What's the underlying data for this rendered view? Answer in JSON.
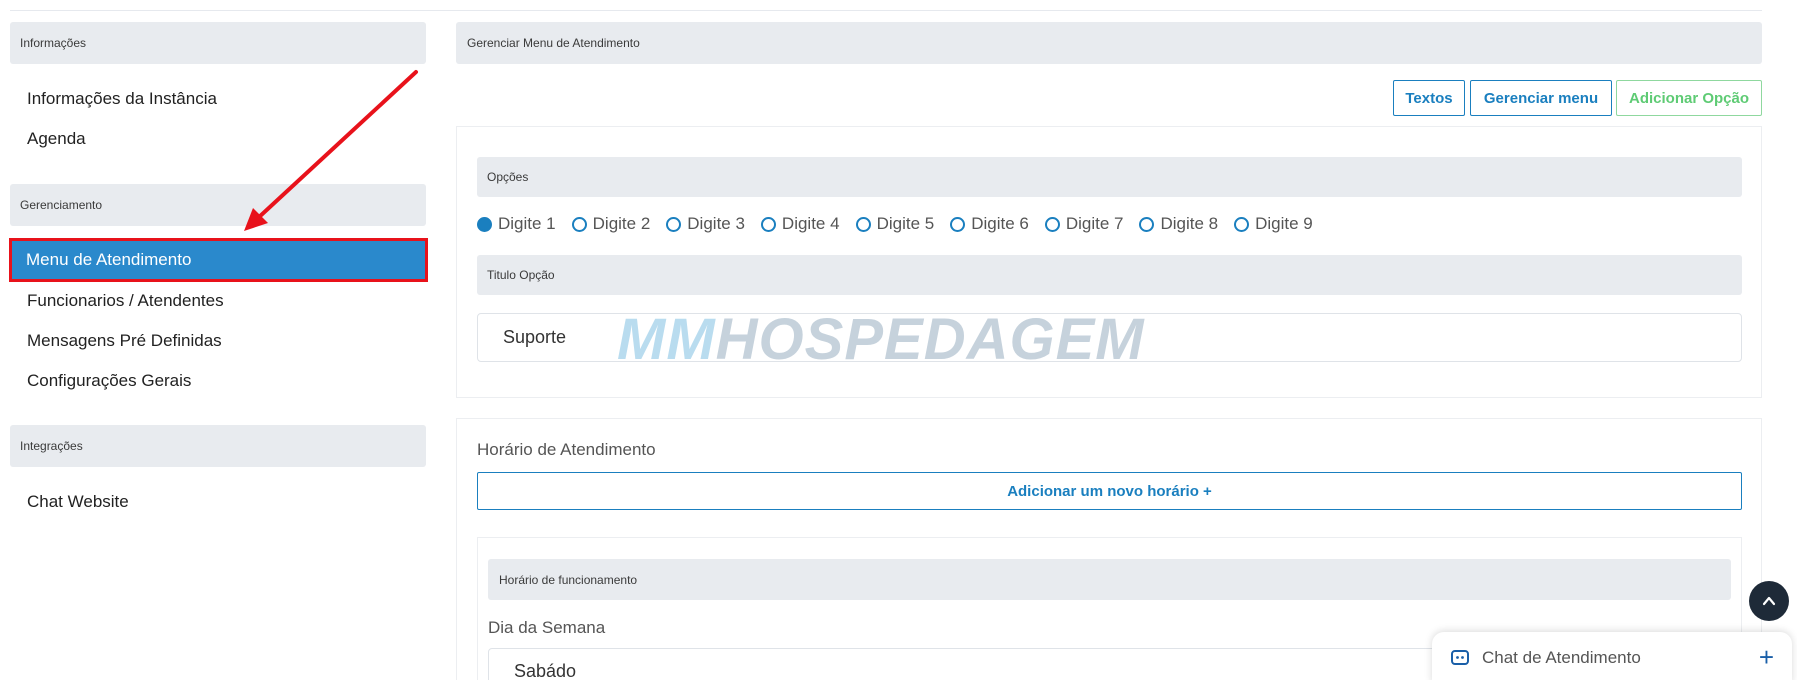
{
  "sidebar": {
    "sections": [
      {
        "title": "Informações"
      },
      {
        "title": "Gerenciamento"
      },
      {
        "title": "Integrações"
      }
    ],
    "items": [
      {
        "label": "Informações da Instância"
      },
      {
        "label": "Agenda"
      },
      {
        "label": "Menu de Atendimento"
      },
      {
        "label": "Funcionarios / Atendentes"
      },
      {
        "label": "Mensagens Pré Definidas"
      },
      {
        "label": "Configurações Gerais"
      },
      {
        "label": "Chat Website"
      }
    ]
  },
  "main": {
    "title": "Gerenciar Menu de Atendimento",
    "buttons": {
      "textos": "Textos",
      "gerenciar_menu": "Gerenciar menu",
      "adicionar_opcao": "Adicionar Opção"
    },
    "options": {
      "header": "Opções",
      "radios": [
        "Digite 1",
        "Digite 2",
        "Digite 3",
        "Digite 4",
        "Digite 5",
        "Digite 6",
        "Digite 7",
        "Digite 8",
        "Digite 9"
      ],
      "selected": "Digite 1",
      "title_header": "Titulo Opção",
      "title_value": "Suporte"
    },
    "watermark": {
      "part1": "MM",
      "part2": "HOSPEDAGEM"
    },
    "schedule": {
      "label": "Horário de Atendimento",
      "add_button": "Adicionar um novo horário  +",
      "inner_header": "Horário de funcionamento",
      "day_label": "Dia da Semana",
      "day_value": "Sabádo"
    }
  },
  "chat_widget": {
    "title": "Chat de Atendimento",
    "plus": "+"
  },
  "colors": {
    "accent": "#1a7fbf",
    "active_bg": "#2a89cc",
    "highlight": "#e8121b",
    "green": "#5ecb74"
  }
}
